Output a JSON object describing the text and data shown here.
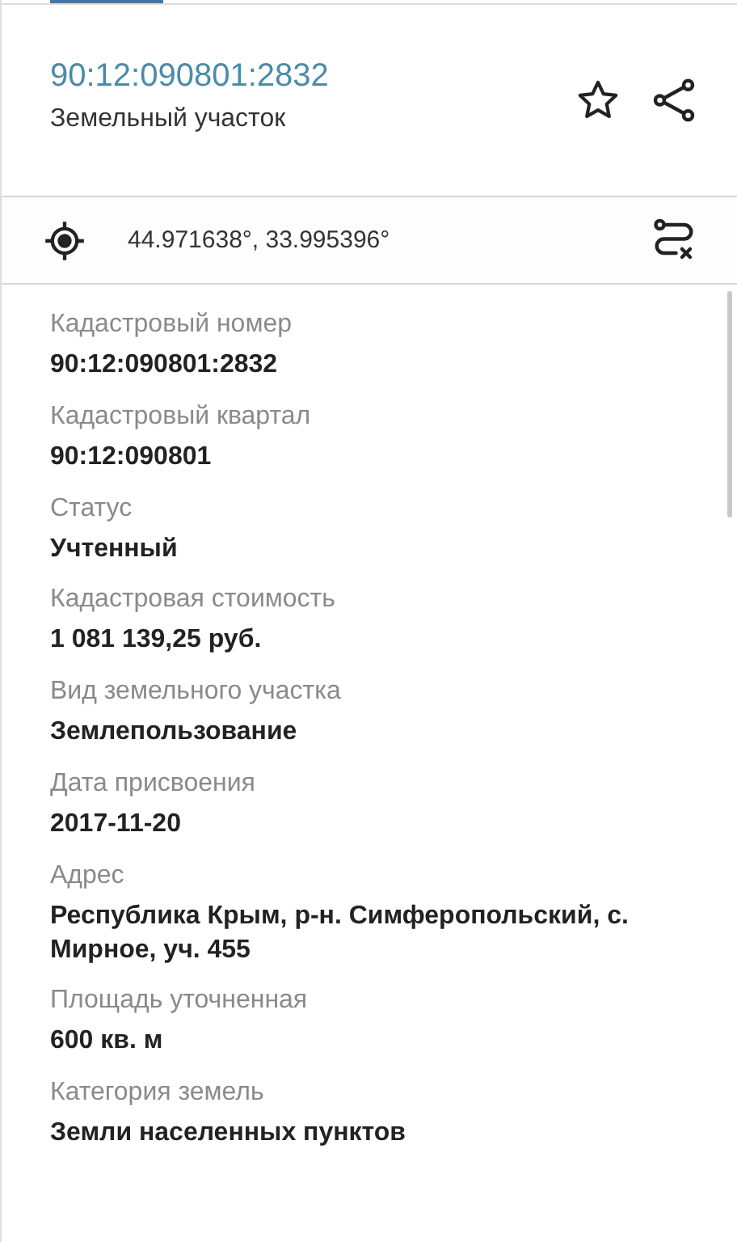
{
  "header": {
    "cadastral_number": "90:12:090801:2832",
    "object_type": "Земельный участок"
  },
  "coordinates": "44.971638°, 33.995396°",
  "details": [
    {
      "label": "Кадастровый номер",
      "value": "90:12:090801:2832"
    },
    {
      "label": "Кадастровый квартал",
      "value": "90:12:090801"
    },
    {
      "label": "Статус",
      "value": "Учтенный"
    },
    {
      "label": "Кадастровая стоимость",
      "value": "1 081 139,25 руб."
    },
    {
      "label": "Вид земельного участка",
      "value": "Землепользование"
    },
    {
      "label": "Дата присвоения",
      "value": "2017-11-20"
    },
    {
      "label": "Адрес",
      "value": "Республика Крым, р-н. Симферопольский, с. Мирное, уч. 455"
    },
    {
      "label": "Площадь уточненная",
      "value": "600 кв. м"
    },
    {
      "label": "Категория земель",
      "value": "Земли населенных пунктов"
    }
  ]
}
